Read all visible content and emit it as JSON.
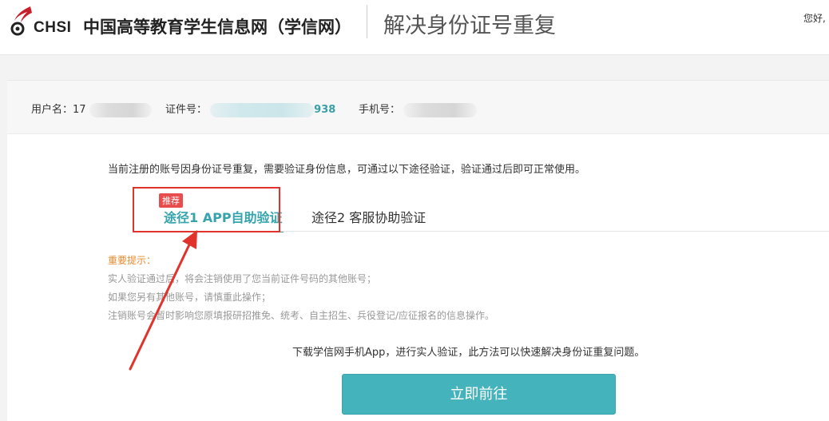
{
  "header": {
    "logo_text": "CHSI",
    "site_name": "中国高等教育学生信息网（学信网）",
    "page_title": "解决身份证号重复",
    "greeting": "您好,"
  },
  "info_bar": {
    "username_label": "用户名：",
    "username_value": "17",
    "id_label": "证件号：",
    "id_suffix": "938",
    "phone_label": "手机号："
  },
  "notice": "当前注册的账号因身份证号重复，需要验证身份信息，可通过以下途径验证，验证通过后即可正常使用。",
  "tabs": [
    {
      "label": "途径1 APP自助验证",
      "badge": "推荐",
      "active": true
    },
    {
      "label": "途径2 客服协助验证",
      "active": false
    }
  ],
  "tips": {
    "title": "重要提示：",
    "lines": [
      "实人验证通过后，将会注销使用了您当前证件号码的其他账号；",
      "如果您另有其他账号，请慎重此操作；",
      "注销账号会暂时影响您原填报研招推免、统考、自主招生、兵役登记/应征报名的信息操作。"
    ]
  },
  "download_text": "下载学信网手机App，进行实人验证，此方法可以快速解决身份证重复问题。",
  "button_label": "立即前往",
  "colors": {
    "accent": "#36a4ac",
    "button": "#45b3bb",
    "badge": "#e84c4c",
    "annotation": "#e0332b",
    "tips_title": "#e58a2e"
  }
}
